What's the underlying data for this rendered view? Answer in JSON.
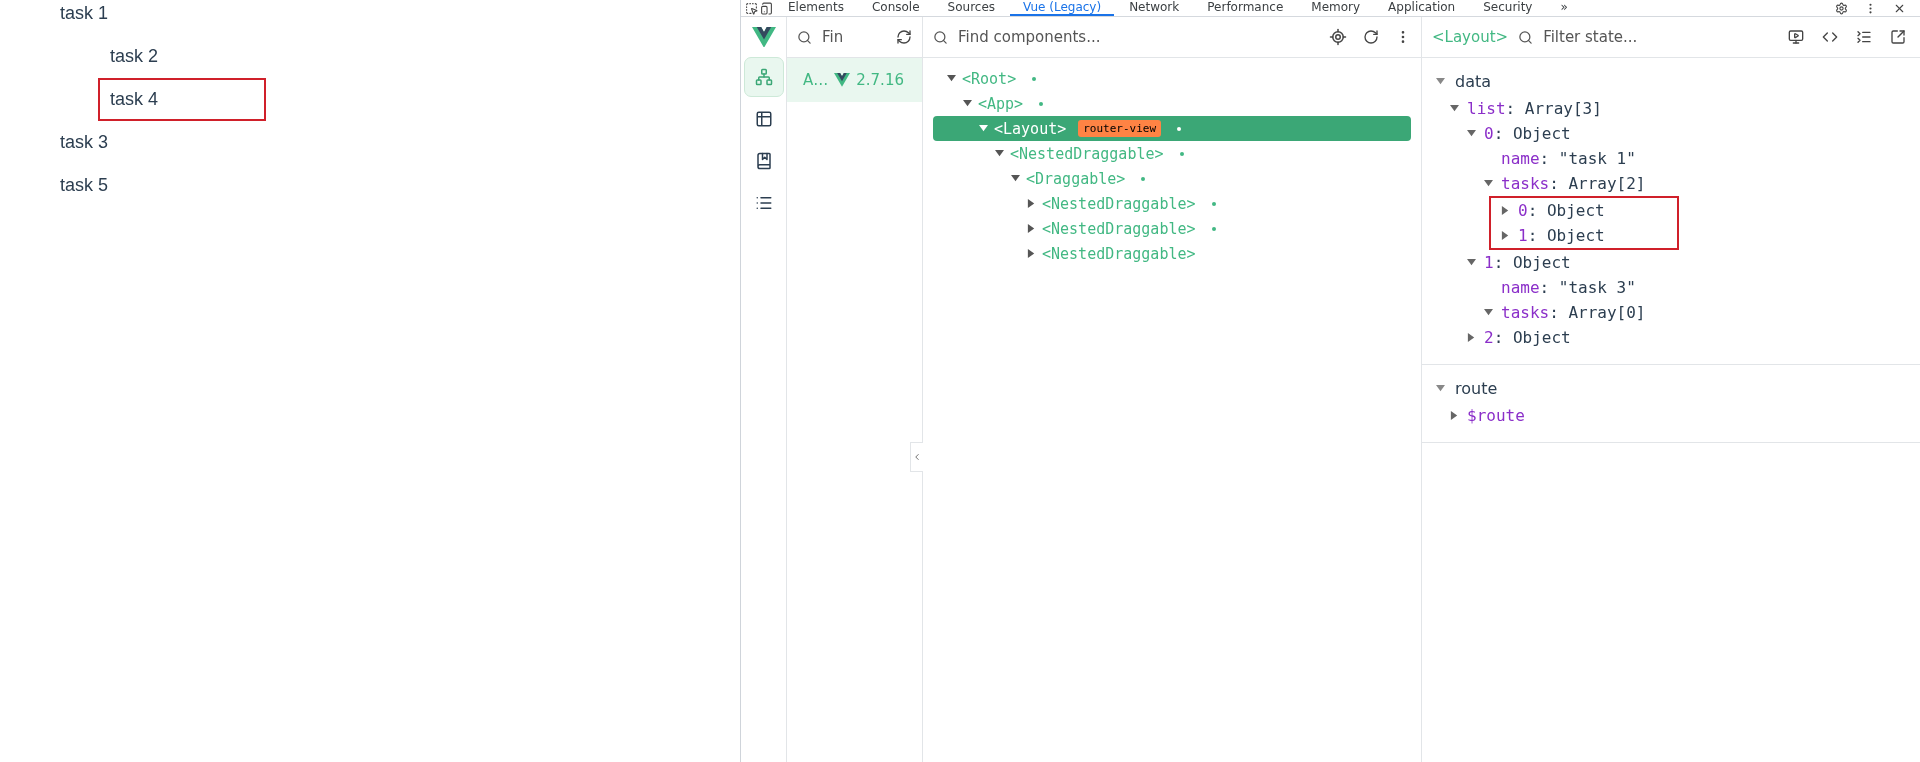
{
  "page": {
    "tasks": [
      {
        "name": "task 1",
        "boxed": false,
        "children": [
          {
            "name": "task 2",
            "boxed": false
          },
          {
            "name": "task 4",
            "boxed": true
          }
        ]
      },
      {
        "name": "task 3",
        "boxed": false
      },
      {
        "name": "task 5",
        "boxed": false
      }
    ]
  },
  "devtools": {
    "tabs": [
      {
        "label": "Elements",
        "selected": false
      },
      {
        "label": "Console",
        "selected": false
      },
      {
        "label": "Sources",
        "selected": false
      },
      {
        "label": "Vue (Legacy)",
        "selected": true
      },
      {
        "label": "Network",
        "selected": false
      },
      {
        "label": "Performance",
        "selected": false
      },
      {
        "label": "Memory",
        "selected": false
      },
      {
        "label": "Application",
        "selected": false
      },
      {
        "label": "Security",
        "selected": false
      }
    ],
    "tabs_overflow": "»",
    "sidebar": [
      {
        "kind": "components",
        "selected": true
      },
      {
        "kind": "timeline",
        "selected": false
      },
      {
        "kind": "docs",
        "selected": false
      },
      {
        "kind": "list",
        "selected": false
      }
    ],
    "apps": {
      "search_placeholder": "Fin",
      "items": [
        {
          "name": "A…",
          "version": "2.7.16",
          "selected": true
        }
      ]
    },
    "components": {
      "search_placeholder": "Find components...",
      "tree": [
        {
          "name": "<Root>",
          "expanded": true,
          "selected": false,
          "dot": true,
          "children": [
            {
              "name": "<App>",
              "expanded": true,
              "selected": false,
              "dot": true,
              "children": [
                {
                  "name": "<Layout>",
                  "expanded": true,
                  "selected": true,
                  "dot": true,
                  "badge": "router-view",
                  "children": [
                    {
                      "name": "<NestedDraggable>",
                      "expanded": true,
                      "selected": false,
                      "dot": true,
                      "children": [
                        {
                          "name": "<Draggable>",
                          "expanded": true,
                          "selected": false,
                          "dot": true,
                          "children": [
                            {
                              "name": "<NestedDraggable>",
                              "expanded": false,
                              "selected": false,
                              "dot": true
                            },
                            {
                              "name": "<NestedDraggable>",
                              "expanded": false,
                              "selected": false,
                              "dot": true
                            },
                            {
                              "name": "<NestedDraggable>",
                              "expanded": false,
                              "selected": false,
                              "dot": false
                            }
                          ]
                        }
                      ]
                    }
                  ]
                }
              ]
            }
          ]
        }
      ]
    },
    "inspector": {
      "component": "<Layout>",
      "search_placeholder": "Filter state...",
      "sections": [
        {
          "title": "data",
          "expanded": true,
          "nodes": [
            {
              "key": "list",
              "value": ": Array[3]",
              "expanded": true,
              "children": [
                {
                  "key": "0",
                  "value": ": Object",
                  "expanded": true,
                  "children": [
                    {
                      "key": "name",
                      "value": ": \"task 1\""
                    },
                    {
                      "key": "tasks",
                      "value": ": Array[2]",
                      "expanded": true,
                      "boxed_children": true,
                      "children": [
                        {
                          "key": "0",
                          "value": ": Object",
                          "expanded": false
                        },
                        {
                          "key": "1",
                          "value": ": Object",
                          "expanded": false
                        }
                      ]
                    }
                  ]
                },
                {
                  "key": "1",
                  "value": ": Object",
                  "expanded": true,
                  "children": [
                    {
                      "key": "name",
                      "value": ": \"task 3\""
                    },
                    {
                      "key": "tasks",
                      "value": ": Array[0]",
                      "expanded": true
                    }
                  ]
                },
                {
                  "key": "2",
                  "value": ": Object",
                  "expanded": false
                }
              ]
            }
          ]
        },
        {
          "title": "route",
          "expanded": true,
          "nodes": [
            {
              "key": "$route",
              "expanded": false
            }
          ]
        }
      ]
    }
  }
}
